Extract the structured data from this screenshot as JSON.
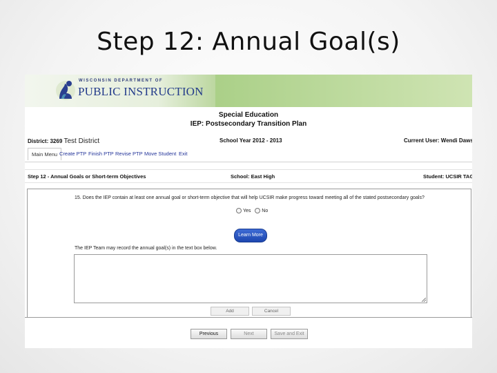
{
  "slide": {
    "title": "Step 12: Annual Goal(s)"
  },
  "logo": {
    "small_text": "WISCONSIN DEPARTMENT OF",
    "big_text": "PUBLIC INSTRUCTION"
  },
  "header": {
    "line1": "Special Education",
    "line2": "IEP: Postsecondary Transition Plan"
  },
  "info": {
    "district_label": "District:",
    "district_number": "3269",
    "district_name": "Test District",
    "school_year": "School Year 2012 - 2013",
    "current_user": "Current User: Wendi Dawson"
  },
  "tabs": [
    "Main Menu",
    "Create PTP",
    "Finish PTP",
    "Revise PTP",
    "Move Student",
    "Exit"
  ],
  "stepbar": {
    "step": "Step 12 - Annual Goals or Short-term Objectives",
    "school": "School: East High",
    "student": "Student: UCSIR TAGDE"
  },
  "form": {
    "question": "15. Does the IEP contain at least one annual goal or short-term objective that will help UCSIR make progress toward meeting all of the stated postsecondary goals?",
    "yes_label": "Yes",
    "no_label": "No",
    "learn_more": "Learn More",
    "instruction": "The IEP Team may record the annual goal(s) in the text box below.",
    "goal_text": "",
    "add_label": "Add",
    "cancel_label": "Cancel"
  },
  "nav": {
    "previous": "Previous",
    "next": "Next",
    "save_exit": "Save and Exit"
  },
  "colors": {
    "banner_green": "#a9cf86",
    "link_blue": "#223399",
    "button_blue": "#1d47b0"
  }
}
